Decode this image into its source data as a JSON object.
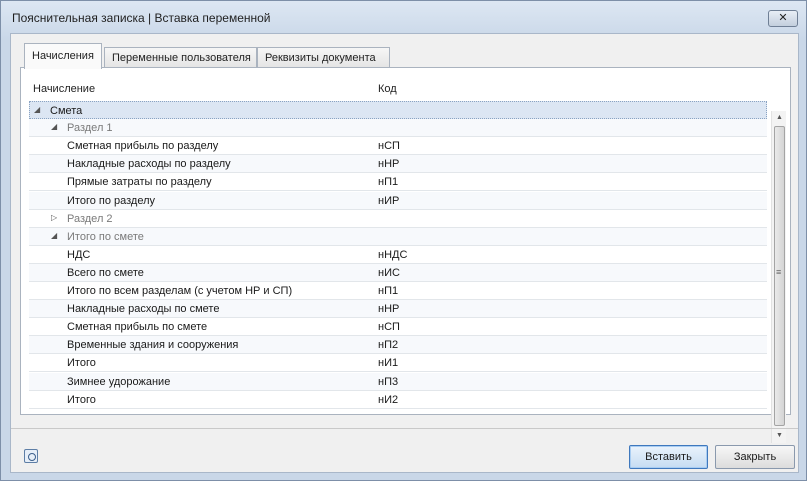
{
  "window": {
    "title": "Пояснительная записка | Вставка переменной",
    "close_glyph": "✕"
  },
  "tabs": [
    {
      "label": "Начисления",
      "active": true
    },
    {
      "label": "Переменные пользователя",
      "active": false
    },
    {
      "label": "Реквизиты документа",
      "active": false
    }
  ],
  "grid": {
    "columns": [
      "Начисление",
      "Код"
    ],
    "rows": [
      {
        "level": 0,
        "type": "group",
        "expanded": true,
        "label": "Смета",
        "code": "",
        "selected": true
      },
      {
        "level": 1,
        "type": "group",
        "expanded": true,
        "label": "Раздел 1",
        "code": ""
      },
      {
        "level": 2,
        "type": "item",
        "label": "Сметная прибыль по разделу",
        "code": "нСП"
      },
      {
        "level": 2,
        "type": "item",
        "label": "Накладные расходы по разделу",
        "code": "нНР"
      },
      {
        "level": 2,
        "type": "item",
        "label": "Прямые затраты по разделу",
        "code": "нП1"
      },
      {
        "level": 2,
        "type": "item",
        "label": "Итого по разделу",
        "code": "нИР"
      },
      {
        "level": 1,
        "type": "group",
        "expanded": false,
        "label": "Раздел 2",
        "code": ""
      },
      {
        "level": 1,
        "type": "group",
        "expanded": true,
        "label": "Итого по смете",
        "code": ""
      },
      {
        "level": 2,
        "type": "item",
        "label": "НДС",
        "code": "нНДС"
      },
      {
        "level": 2,
        "type": "item",
        "label": "Всего по смете",
        "code": "нИС"
      },
      {
        "level": 2,
        "type": "item",
        "label": "Итого по всем разделам (с учетом НР и СП)",
        "code": "нП1"
      },
      {
        "level": 2,
        "type": "item",
        "label": "Накладные расходы по смете",
        "code": "нНР"
      },
      {
        "level": 2,
        "type": "item",
        "label": "Сметная прибыль по смете",
        "code": "нСП"
      },
      {
        "level": 2,
        "type": "item",
        "label": "Временные здания и сооружения",
        "code": "нП2"
      },
      {
        "level": 2,
        "type": "item",
        "label": "Итого",
        "code": "нИ1"
      },
      {
        "level": 2,
        "type": "item",
        "label": "Зимнее удорожание",
        "code": "нП3"
      },
      {
        "level": 2,
        "type": "item",
        "label": "Итого",
        "code": "нИ2"
      }
    ]
  },
  "icons": {
    "expanded": "◢",
    "collapsed": "▷",
    "scroll_up": "▲",
    "scroll_down": "▼",
    "grip": "≡"
  },
  "buttons": {
    "insert": "Вставить",
    "close": "Закрыть"
  }
}
